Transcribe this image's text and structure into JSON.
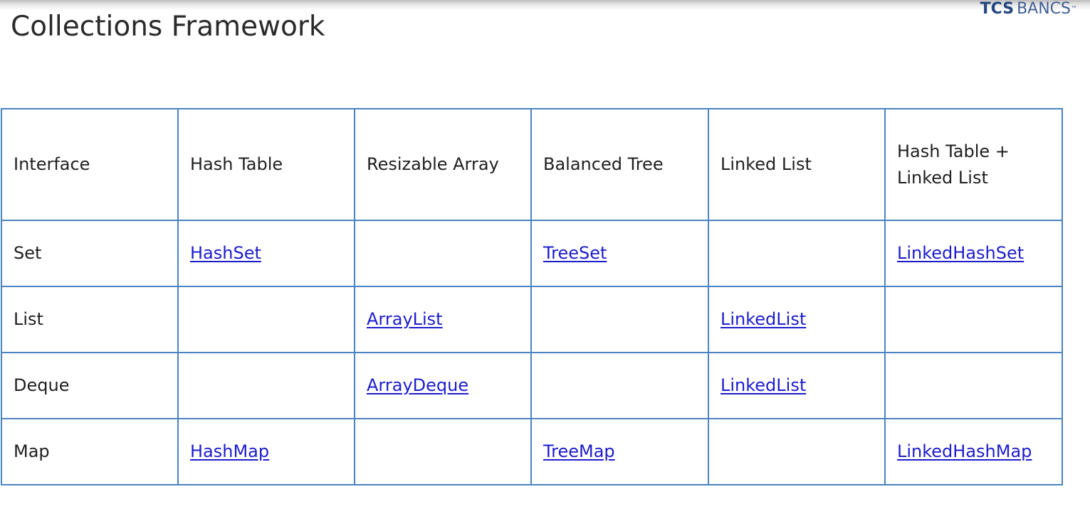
{
  "slide": {
    "title": "Collections Framework",
    "logo": {
      "brand": "TCS",
      "product": "BΑNCS",
      "trademark": "™"
    }
  },
  "table": {
    "headers": [
      "Interface",
      "Hash Table",
      "Resizable Array",
      "Balanced Tree",
      "Linked List",
      "Hash Table + Linked List"
    ],
    "rows": [
      {
        "interface": "Set",
        "cells": [
          "HashSet",
          "",
          "TreeSet",
          "",
          "LinkedHashSet"
        ]
      },
      {
        "interface": "List",
        "cells": [
          "",
          "ArrayList",
          "",
          "LinkedList",
          ""
        ]
      },
      {
        "interface": "Deque",
        "cells": [
          "",
          "ArrayDeque",
          "",
          "LinkedList",
          ""
        ]
      },
      {
        "interface": "Map",
        "cells": [
          "HashMap",
          "",
          "TreeMap",
          "",
          "LinkedHashMap"
        ]
      }
    ]
  },
  "colors": {
    "grid_border": "#4a84c2",
    "link": "#1c1ccc",
    "text": "#1f1f1f"
  }
}
